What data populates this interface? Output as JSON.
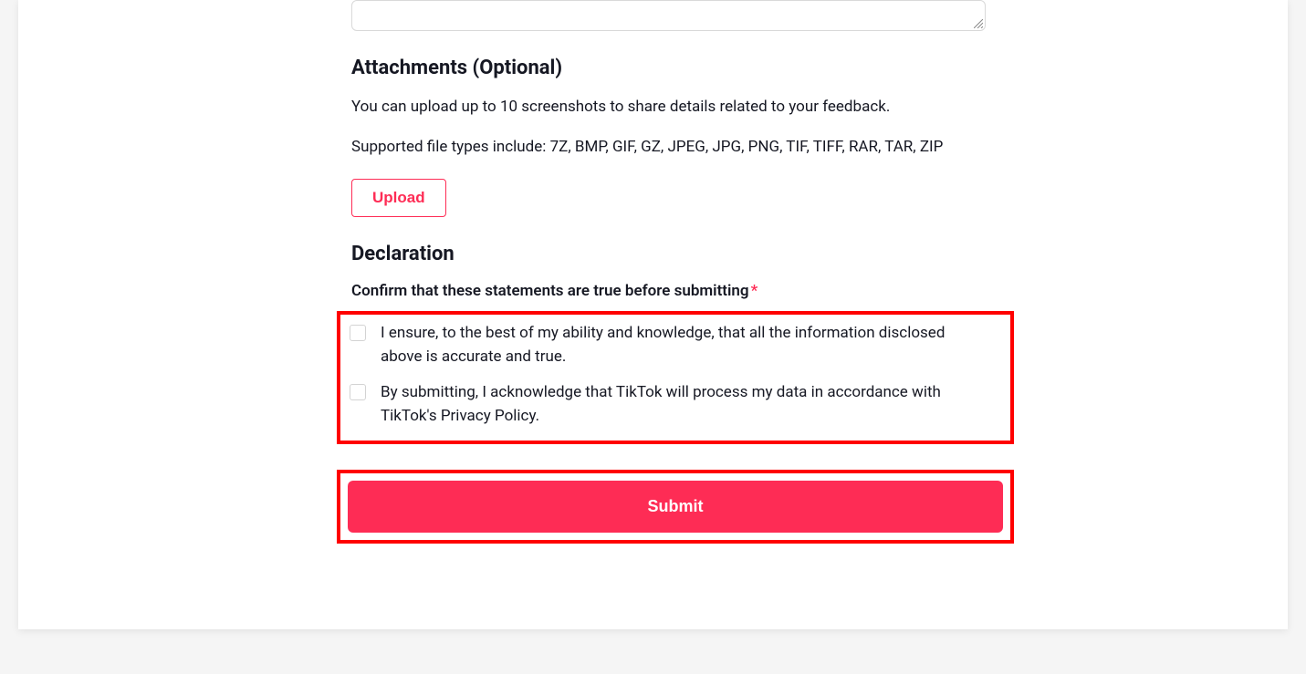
{
  "attachments": {
    "heading": "Attachments (Optional)",
    "help_text_1": "You can upload up to 10 screenshots to share details related to your feedback.",
    "help_text_2": "Supported file types include: 7Z, BMP, GIF, GZ, JPEG, JPG, PNG, TIF, TIFF, RAR, TAR, ZIP",
    "upload_label": "Upload"
  },
  "declaration": {
    "heading": "Declaration",
    "confirm_label": "Confirm that these statements are true before submitting",
    "required_mark": "*",
    "checkbox_1": "I ensure, to the best of my ability and knowledge, that all the information disclosed above is accurate and true.",
    "checkbox_2": "By submitting, I acknowledge that TikTok will process my data in accordance with TikTok's Privacy Policy."
  },
  "submit": {
    "label": "Submit"
  }
}
